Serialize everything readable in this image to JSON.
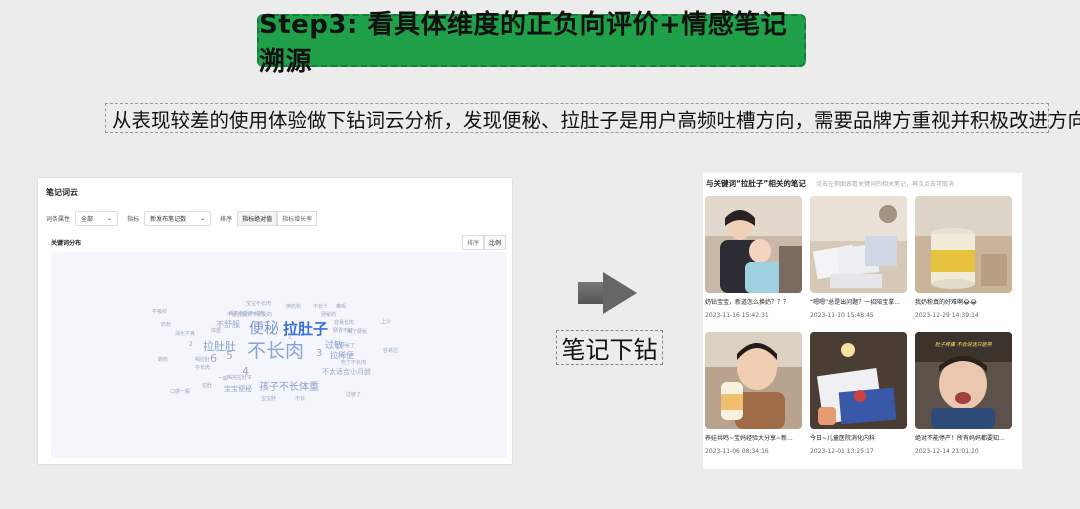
{
  "title": "Step3: 看具体维度的正负向评价+情感笔记溯源",
  "subtitle": "从表现较差的使用体验做下钻词云分析，发现便秘、拉肚子是用户高频吐槽方向，需要品牌方重视并积极改进方向",
  "wordcloud_panel": {
    "title": "笔记词云",
    "filter_label": "词条属性",
    "filter_value": "全部",
    "metric_label": "指标",
    "metric_value": "新发布笔记数",
    "sort_label": "排序",
    "sort_options": [
      "指标绝对值",
      "指标增长率"
    ],
    "section_title": "关键词分布",
    "view_options": [
      "排序",
      "比例"
    ],
    "words": [
      {
        "text": "不长肉"
      },
      {
        "text": "便秘"
      },
      {
        "text": "拉肚子"
      },
      {
        "text": "拉肚肚"
      },
      {
        "text": "孩子不长体重"
      },
      {
        "text": "拉稀便"
      },
      {
        "text": "过敏"
      },
      {
        "text": "不舒服"
      },
      {
        "text": "宝宝便秘"
      },
      {
        "text": "不太适合小月龄"
      },
      {
        "text": "不适合肠胃不耐受的"
      },
      {
        "text": "5"
      },
      {
        "text": "6"
      },
      {
        "text": "4"
      },
      {
        "text": "3"
      },
      {
        "text": "2"
      },
      {
        "text": "1"
      },
      {
        "text": "喝拉肚"
      },
      {
        "text": "不长肉"
      },
      {
        "text": "体重"
      },
      {
        "text": "喝奶粉后不长肉"
      },
      {
        "text": "便秘的"
      },
      {
        "text": "容易长肉"
      },
      {
        "text": "肠胃不好"
      },
      {
        "text": "宝宝胖"
      },
      {
        "text": "吃了不长肉"
      },
      {
        "text": "换奶粉"
      },
      {
        "text": "不长个"
      },
      {
        "text": "消化不良"
      },
      {
        "text": "喝完拉肚子"
      },
      {
        "text": "拉肚"
      },
      {
        "text": "不长"
      },
      {
        "text": "便秘了"
      },
      {
        "text": "喝了便秘"
      },
      {
        "text": "一般"
      },
      {
        "text": "奶粉"
      },
      {
        "text": "上火"
      },
      {
        "text": "容易拉"
      },
      {
        "text": "口感一般"
      },
      {
        "text": "宝宝不长肉"
      },
      {
        "text": "不吸收"
      },
      {
        "text": "难喝"
      },
      {
        "text": "转奶"
      },
      {
        "text": "过敏了"
      }
    ]
  },
  "drill_label": "笔记下钻",
  "notes_panel": {
    "title": "与关键词“拉肚子”相关的笔记",
    "hint": "点击左侧图表看关键词的相关笔记，再次点击可取消",
    "notes": [
      {
        "caption": "奶钻宝宝，新道怎么换奶？？？",
        "date": "2023-11-16 15:42:31"
      },
      {
        "caption": "“嗯嗯”总是出问题？一招陪宝拿...",
        "date": "2023-11-10 15:48:45"
      },
      {
        "caption": "我奶粉真的好难啊😂😂",
        "date": "2023-12-29 14:39:14"
      },
      {
        "caption": "养娃共鸣~宝妈经验大分享~新...",
        "date": "2023-11-06 08:34:16"
      },
      {
        "caption": "今日~儿童医院消化内科",
        "date": "2023-12-01 13:25:17"
      },
      {
        "caption": "绝对不能停产！所有妈妈都要知...",
        "date": "2023-12-14 21:01:20"
      }
    ],
    "overlay_text": "肚子疼痛 不会说话只能哭"
  },
  "colors": {
    "accent_green": "#21a04a",
    "cloud_word": "#9aa8c4",
    "cloud_highlight": "#3b6fd6"
  }
}
